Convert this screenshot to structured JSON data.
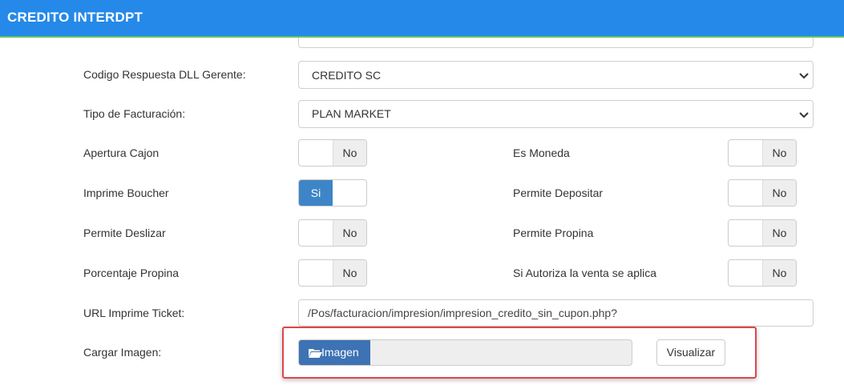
{
  "header": {
    "title": "CREDITO INTERDPT"
  },
  "form": {
    "codigo_respuesta": {
      "label": "Codigo Respuesta DLL Gerente:",
      "value": "CREDITO SC"
    },
    "tipo_facturacion": {
      "label": "Tipo de Facturación:",
      "value": "PLAN MARKET"
    },
    "apertura_cajon": {
      "label": "Apertura Cajon",
      "value": "No"
    },
    "es_moneda": {
      "label": "Es Moneda",
      "value": "No"
    },
    "imprime_boucher": {
      "label": "Imprime Boucher",
      "value": "Si"
    },
    "permite_depositar": {
      "label": "Permite Depositar",
      "value": "No"
    },
    "permite_deslizar": {
      "label": "Permite Deslizar",
      "value": "No"
    },
    "permite_propina": {
      "label": "Permite Propina",
      "value": "No"
    },
    "porcentaje_propina": {
      "label": "Porcentaje Propina",
      "value": "No"
    },
    "si_autoriza": {
      "label": "Si Autoriza la venta se aplica",
      "value": "No"
    },
    "url_imprime": {
      "label": "URL Imprime Ticket:",
      "value": "/Pos/facturacion/impresion/impresion_credito_sin_cupon.php?"
    },
    "cargar_imagen": {
      "label": "Cargar Imagen:",
      "button_label": "Imagen",
      "file_value": "",
      "visualizar_label": "Visualizar"
    }
  },
  "colors": {
    "header_bg": "#2489e8",
    "toggle_on": "#3d85c6",
    "highlight": "#e0454a"
  }
}
